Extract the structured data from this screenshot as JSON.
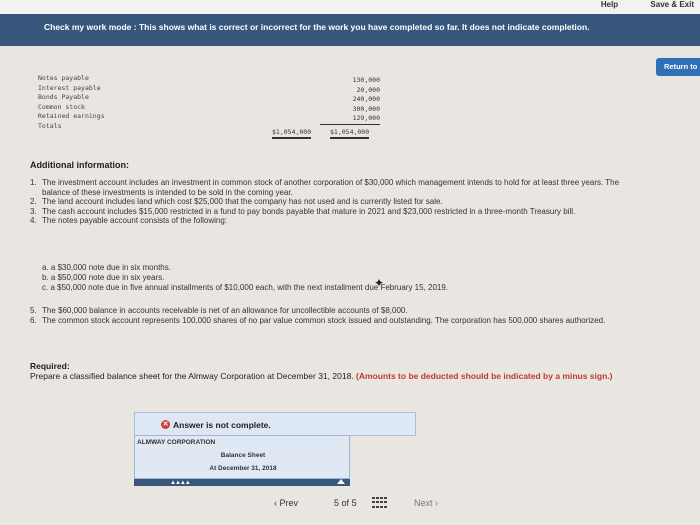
{
  "toplinks": {
    "help": "Help",
    "save_exit": "Save & Exit"
  },
  "banner": {
    "text": "Check my work mode : This shows what is correct or incorrect for the work you have completed so far. It does not indicate completion."
  },
  "return_button": "Return to",
  "financials": {
    "labels": [
      "Notes payable",
      "Interest payable",
      "Bonds Payable",
      "Common stock",
      "Retained earnings",
      "Totals"
    ],
    "col2": [
      "130,000",
      "20,000",
      "240,000",
      "300,000",
      "129,000"
    ],
    "total1": "$1,054,000",
    "total2": "$1,054,000"
  },
  "additional": {
    "title": "Additional information:",
    "items": [
      {
        "num": "1.",
        "text": "The investment account includes an investment in common stock of another corporation of $30,000 which management intends to hold for at least three years. The balance of these investments is intended to be sold in the coming year."
      },
      {
        "num": "2.",
        "text": "The land account includes land which cost $25,000 that the company has not used and is currently listed for sale."
      },
      {
        "num": "3.",
        "text": "The cash account includes $15,000 restricted in a fund to pay bonds payable that mature in 2021 and $23,000 restricted in a three-month Treasury bill."
      },
      {
        "num": "4.",
        "text": "The notes payable account consists of the following:"
      }
    ],
    "sub_items": [
      "a. a $30,000 note due in six months.",
      "b. a $50,000 note due in six years.",
      "c. a $50,000 note due in five annual installments of $10,000 each, with the next installment due February 15, 2019."
    ],
    "items2": [
      {
        "num": "5.",
        "text": "The $60,000 balance in accounts receivable is net of an allowance for uncollectible accounts of $8,000."
      },
      {
        "num": "6.",
        "text": "The common stock account represents 100,000 shares of no par value common stock issued and outstanding. The corporation has 500,000 shares authorized."
      }
    ]
  },
  "required": {
    "title": "Required:",
    "text": "Prepare a classified balance sheet for the Almway Corporation at December 31, 2018.",
    "note": "(Amounts to be deducted should be indicated by a minus sign.)"
  },
  "answer": {
    "status": "Answer is not complete."
  },
  "worksheet": {
    "company": "ALMWAY CORPORATION",
    "sheet": "Balance Sheet",
    "date": "At December 31, 2018"
  },
  "pager": {
    "prev": "Prev",
    "page": "5",
    "of": "of",
    "total": "5",
    "next": "Next"
  }
}
